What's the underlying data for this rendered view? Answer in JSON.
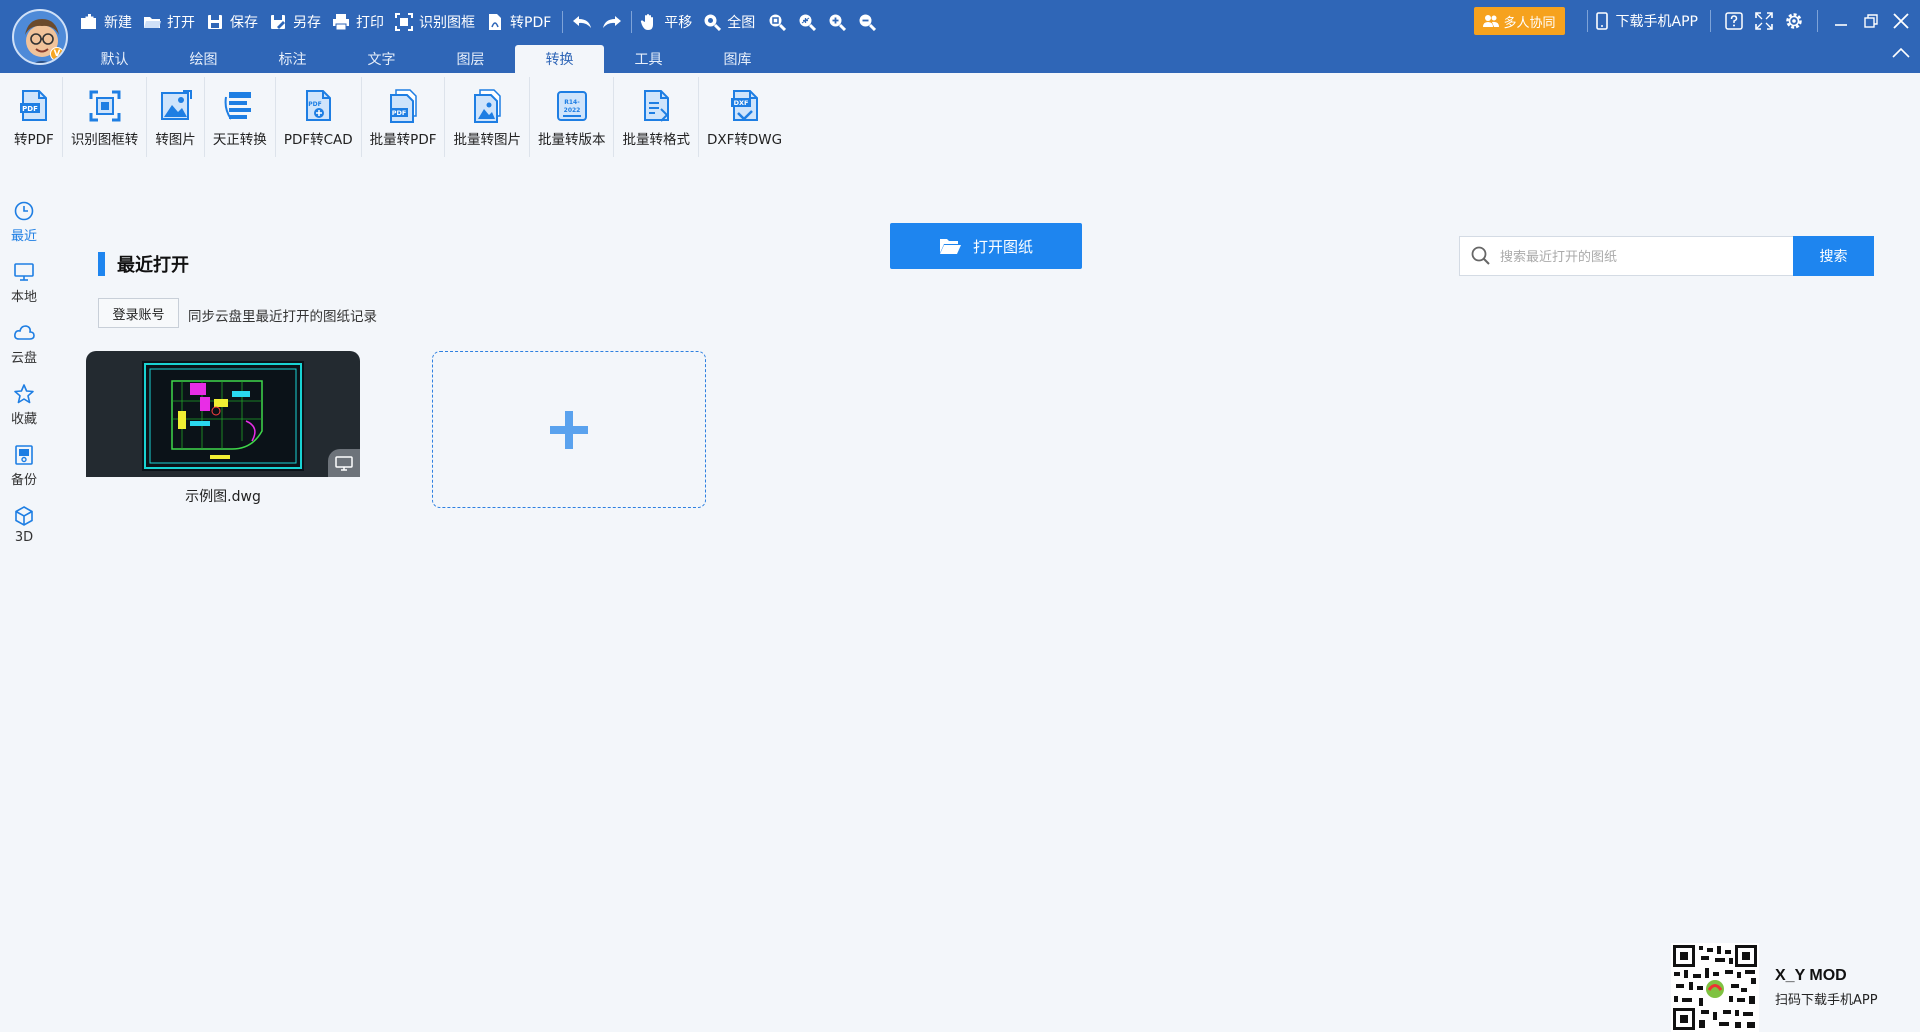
{
  "quickbar": {
    "new_label": "新建",
    "open_label": "打开",
    "save_label": "保存",
    "saveas_label": "另存",
    "print_label": "打印",
    "recognize_label": "识别图框",
    "topdf_label": "转PDF",
    "pan_label": "平移",
    "fit_label": "全图"
  },
  "tabs": [
    {
      "label": "默认"
    },
    {
      "label": "绘图"
    },
    {
      "label": "标注"
    },
    {
      "label": "文字"
    },
    {
      "label": "图层"
    },
    {
      "label": "转换",
      "active": true
    },
    {
      "label": "工具"
    },
    {
      "label": "图库"
    }
  ],
  "topright": {
    "collab_label": "多人协同",
    "download_app_label": "下载手机APP"
  },
  "ribbon": [
    {
      "label": "转PDF",
      "icon": "pdf-export-icon"
    },
    {
      "label": "识别图框转",
      "icon": "frame-recognize-icon"
    },
    {
      "label": "转图片",
      "icon": "image-export-icon"
    },
    {
      "label": "天正转换",
      "icon": "tangent-convert-icon"
    },
    {
      "label": "PDF转CAD",
      "icon": "pdf-to-cad-icon"
    },
    {
      "label": "批量转PDF",
      "icon": "batch-pdf-icon"
    },
    {
      "label": "批量转图片",
      "icon": "batch-image-icon"
    },
    {
      "label": "批量转版本",
      "icon": "batch-version-icon"
    },
    {
      "label": "批量转格式",
      "icon": "batch-format-icon"
    },
    {
      "label": "DXF转DWG",
      "icon": "dxf-to-dwg-icon"
    }
  ],
  "ribbon_icon_text": {
    "pdf": "PDF",
    "ver_line1": "R14-",
    "ver_line2": "2022",
    "dxf": "DXF"
  },
  "leftnav": [
    {
      "label": "最近",
      "icon": "clock-icon",
      "active": true
    },
    {
      "label": "本地",
      "icon": "monitor-icon"
    },
    {
      "label": "云盘",
      "icon": "cloud-icon"
    },
    {
      "label": "收藏",
      "icon": "star-icon"
    },
    {
      "label": "备份",
      "icon": "backup-icon"
    },
    {
      "label": "3D",
      "icon": "cube-icon"
    }
  ],
  "main": {
    "open_drawing_label": "打开图纸",
    "search_placeholder": "搜索最近打开的图纸",
    "search_button": "搜索",
    "section_title": "最近打开",
    "login_button": "登录账号",
    "sync_text": "同步云盘里最近打开的图纸记录",
    "recent_files": [
      {
        "name": "示例图.dwg"
      }
    ]
  },
  "qr": {
    "title": "X_Y MOD",
    "subtitle": "扫码下载手机APP"
  },
  "colors": {
    "topbar": "#2f66b7",
    "accent": "#1e85ef",
    "orange": "#f6a21e"
  }
}
